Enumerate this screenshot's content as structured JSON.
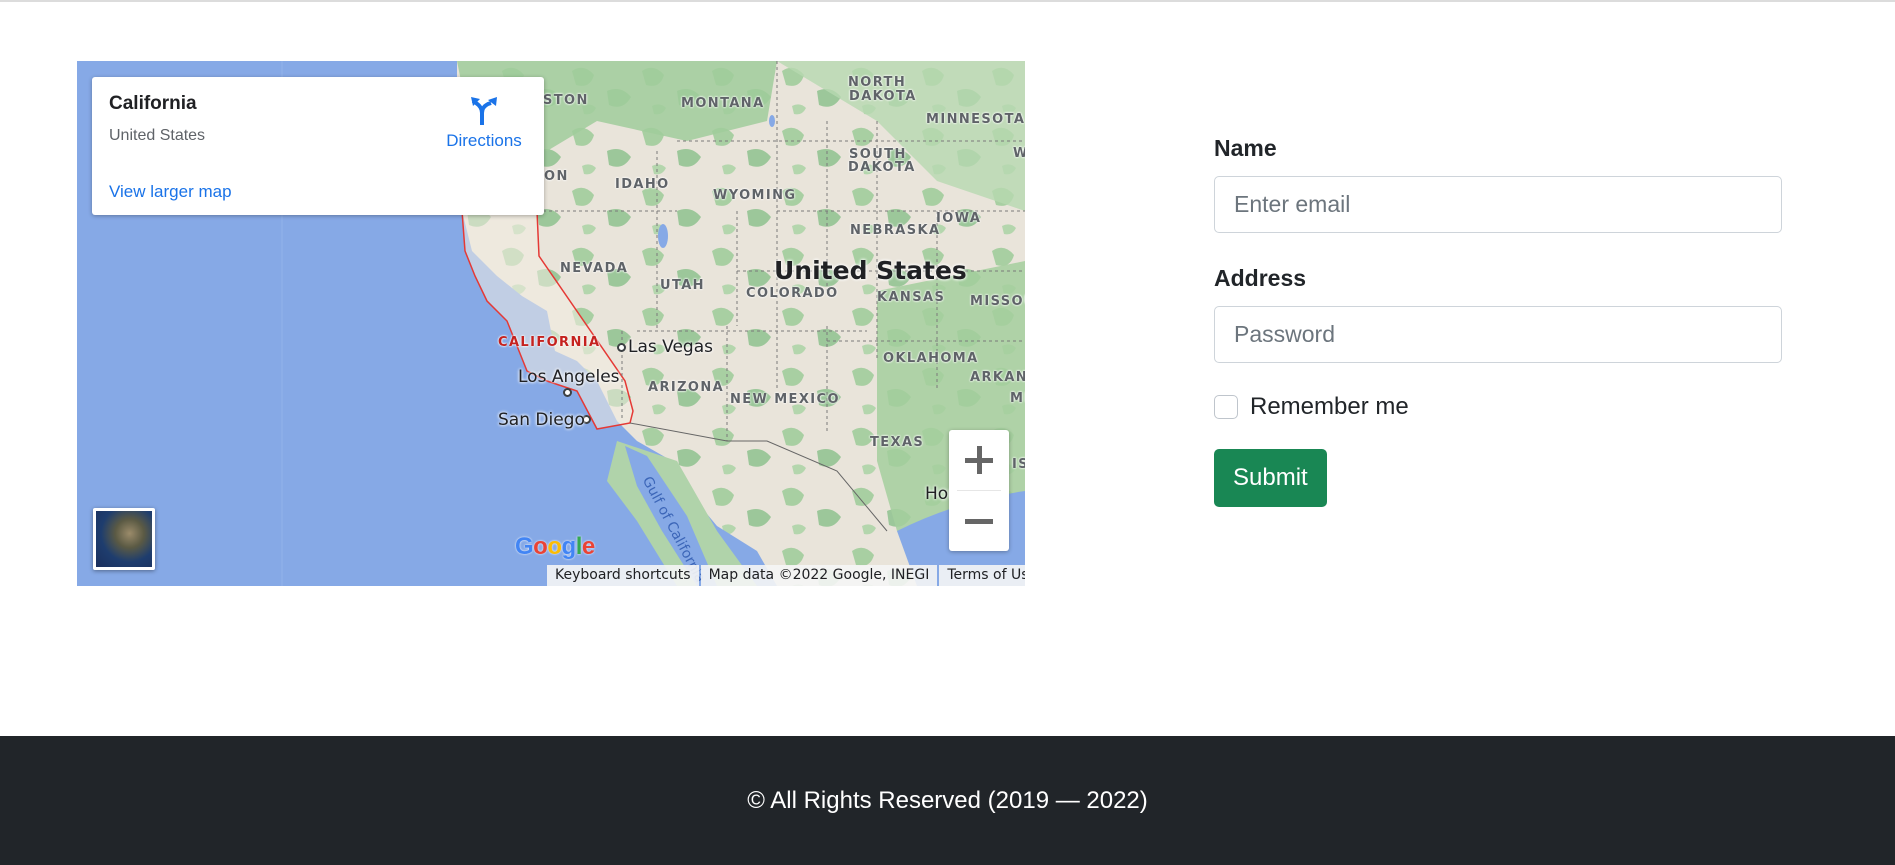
{
  "map": {
    "info_card": {
      "title": "California",
      "subtitle": "United States",
      "directions_label": "Directions",
      "larger_map_label": "View larger map"
    },
    "country_label": "United States",
    "state_labels": [
      "NORTH",
      "DAKOTA",
      "MONTANA",
      "MINNESOTA",
      "SOUTH",
      "DAKOTA",
      "IDAHO",
      "WYOMING",
      "NEBRASKA",
      "IOWA",
      "NEVADA",
      "UTAH",
      "COLORADO",
      "KANSAS",
      "MISSOU",
      "ARIZONA",
      "NEW MEXICO",
      "OKLAHOMA",
      "ARKANS",
      "TEXAS",
      "STON",
      "ON",
      "W",
      "MI",
      "IS"
    ],
    "highlight_label": "CALIFORNIA",
    "cities": [
      "Las Vegas",
      "Los Angeles",
      "San Diego",
      "Hou"
    ],
    "water_label": "Gulf of California",
    "google_logo": [
      "G",
      "o",
      "o",
      "g",
      "l",
      "e"
    ],
    "attribution": {
      "shortcuts": "Keyboard shortcuts",
      "map_data": "Map data ©2022 Google, INEGI",
      "terms": "Terms of Use"
    },
    "colors": {
      "water": "#86a9e6",
      "land": "#e8e3d9",
      "vegetation": "#a8cfa2",
      "california_border": "#e53935",
      "link": "#1a73e8"
    }
  },
  "form": {
    "name_label": "Name",
    "name_placeholder": "Enter email",
    "address_label": "Address",
    "address_placeholder": "Password",
    "remember_label": "Remember me",
    "submit_label": "Submit",
    "submit_color": "#198754"
  },
  "footer": {
    "text": "© All Rights Reserved (2019 — 2022)"
  }
}
